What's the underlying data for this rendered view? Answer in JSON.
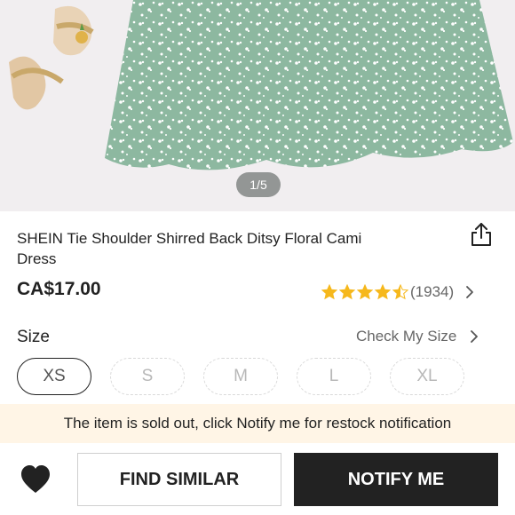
{
  "product": {
    "image_counter": "1/5",
    "title": "SHEIN Tie Shoulder Shirred Back Ditsy Floral Cami Dress",
    "price": "CA$17.00",
    "rating": 4.5,
    "review_count": "(1934)"
  },
  "size": {
    "label": "Size",
    "guide_link": "Check My Size",
    "options": [
      "XS",
      "S",
      "M",
      "L",
      "XL"
    ],
    "selected": "XS"
  },
  "notice": "The item is sold out, click Notify me for restock notification",
  "actions": {
    "find_similar": "FIND SIMILAR",
    "notify_me": "NOTIFY ME"
  },
  "colors": {
    "dress_green": "#8db8a0",
    "star_gold": "#f6b81c",
    "notice_bg": "#fff5e6",
    "primary_button": "#222222"
  },
  "icons": {
    "share": "share-icon",
    "wishlist": "heart-icon",
    "chevron": "chevron-right-icon",
    "star": "star-icon"
  }
}
